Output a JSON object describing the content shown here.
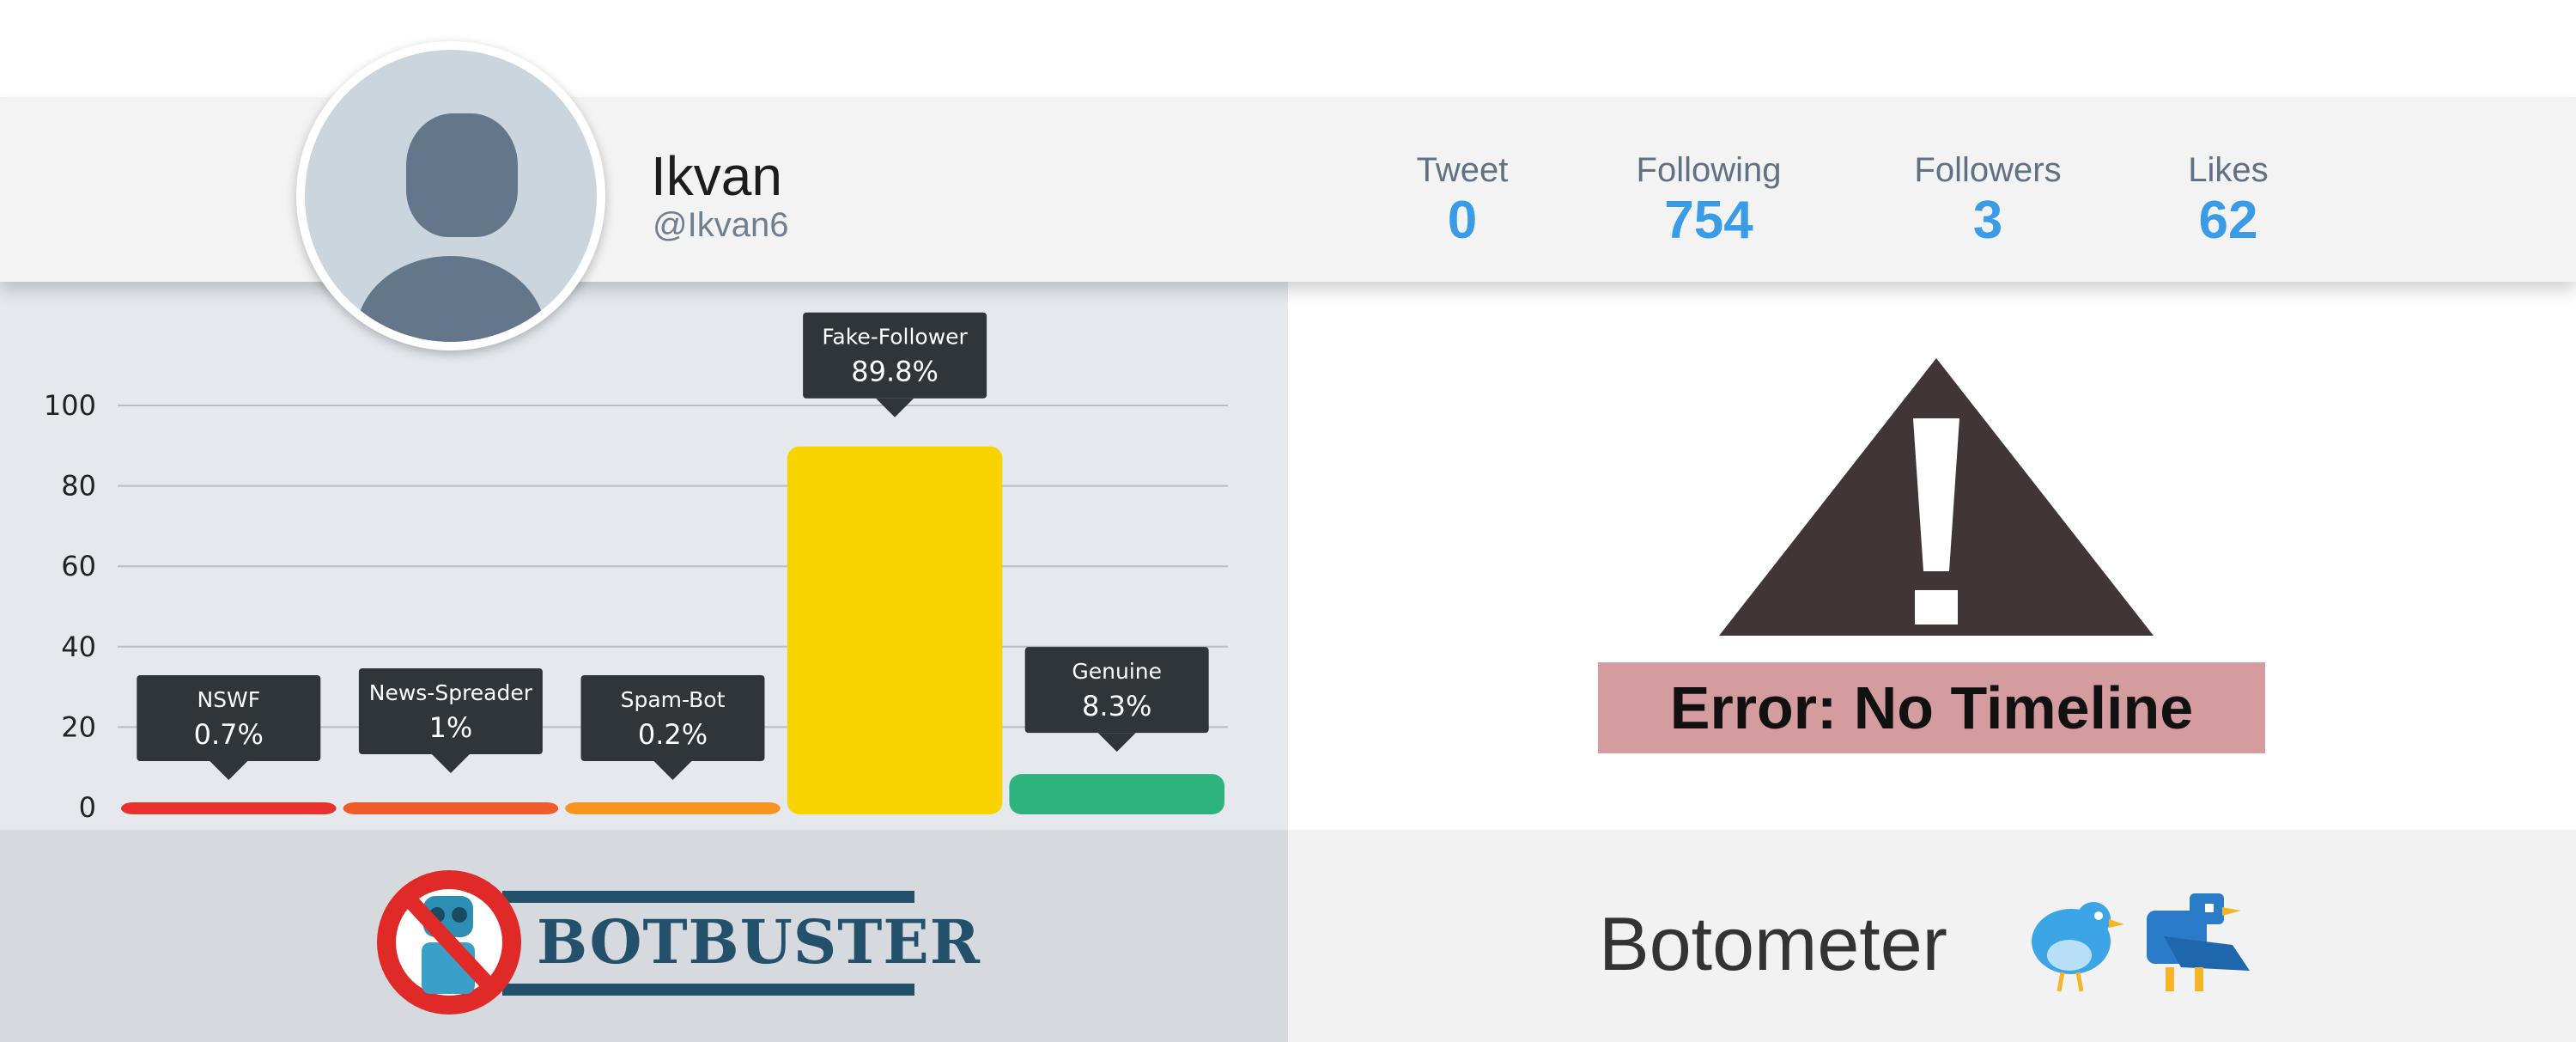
{
  "profile": {
    "display_name": "Ikvan",
    "screen_name": "@Ikvan6",
    "stats": [
      {
        "label": "Tweet",
        "value": "0"
      },
      {
        "label": "Following",
        "value": "754"
      },
      {
        "label": "Followers",
        "value": "3"
      },
      {
        "label": "Likes",
        "value": "62"
      }
    ]
  },
  "chart_data": {
    "type": "bar",
    "categories": [
      "NSWF",
      "News-Spreader",
      "Spam-Bot",
      "Fake-Follower",
      "Genuine"
    ],
    "values": [
      0.7,
      1,
      0.2,
      89.8,
      8.3
    ],
    "value_labels": [
      "0.7%",
      "1%",
      "0.2%",
      "89.8%",
      "8.3%"
    ],
    "colors": [
      "#e8302e",
      "#f15a2b",
      "#f7941d",
      "#f8d300",
      "#2db37b"
    ],
    "yticks": [
      0,
      20,
      40,
      60,
      80,
      100
    ],
    "ylim": [
      0,
      100
    ],
    "grid": true
  },
  "error": {
    "message": "Error: No Timeline"
  },
  "footer": {
    "botbuster_label": "BOTBUSTER",
    "botometer_label": "Botometer"
  },
  "colors": {
    "stat_value": "#3a9be6",
    "warning": "#403637",
    "error_bg": "#d49c9e"
  }
}
